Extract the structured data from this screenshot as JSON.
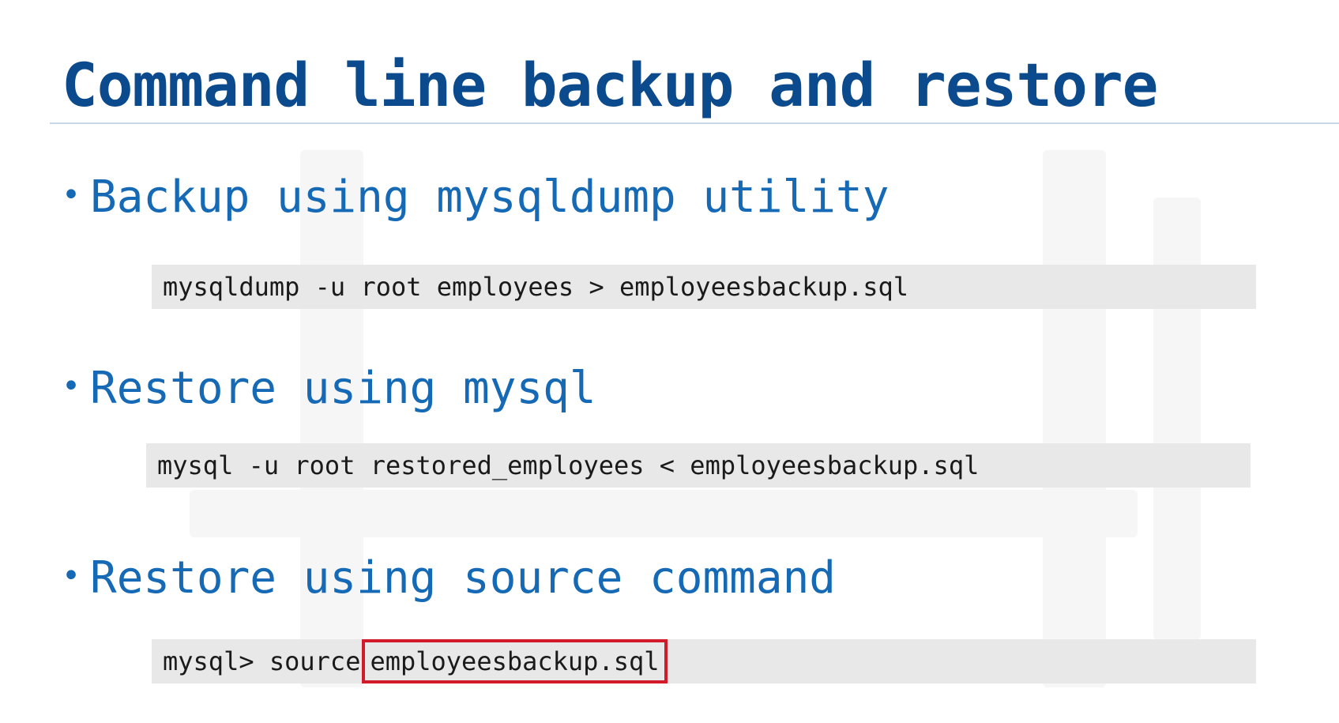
{
  "slide": {
    "title": "Command line backup and restore",
    "bullet_glyph": "•",
    "items": [
      {
        "heading": "Backup using mysqldump utility",
        "code": "mysqldump -u root employees > employeesbackup.sql"
      },
      {
        "heading": "Restore using mysql",
        "code": "mysql -u root restored_employees < employeesbackup.sql"
      },
      {
        "heading": "Restore using source command",
        "code_prefix": "mysql> source",
        "code_highlight": "employeesbackup.sql"
      }
    ]
  },
  "colors": {
    "title": "#0b4a8c",
    "bullet_text": "#1569b5",
    "code_background": "#e8e8e8",
    "highlight_border": "#d11a2a"
  }
}
